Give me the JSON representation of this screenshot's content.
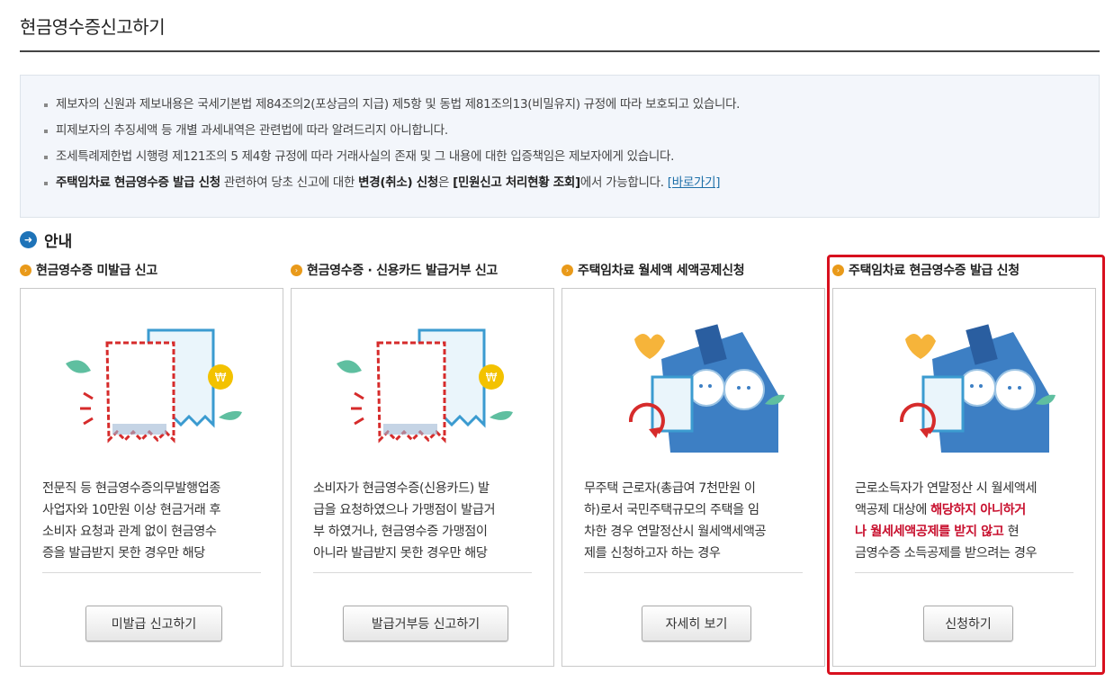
{
  "page": {
    "title": "현금영수증신고하기"
  },
  "notice": {
    "items": [
      {
        "text": "제보자의 신원과 제보내용은 국세기본법 제84조의2(포상금의 지급) 제5항 및 동법 제81조의13(비밀유지) 규정에 따라 보호되고 있습니다."
      },
      {
        "text": "피제보자의 추징세액 등 개별 과세내역은 관련법에 따라 알려드리지 아니합니다."
      },
      {
        "text": "조세특례제한법 시행령 제121조의 5 제4항 규정에 따라 거래사실의 존재 및 그 내용에 대한 입증책임은 제보자에게 있습니다."
      }
    ],
    "last": {
      "bold1": "주택임차료 현금영수증 발급 신청",
      "text1": " 관련하여 당초 신고에 대한 ",
      "bold2": "변경(취소) 신청",
      "text2": "은 ",
      "bold3": "[민원신고 처리현황 조회]",
      "text3": "에서 가능합니다. ",
      "link": "[바로가기]"
    }
  },
  "guide": {
    "title": "안내"
  },
  "cards": [
    {
      "title": "현금영수증 미발급 신고",
      "lines": [
        "전문직 등 현금영수증의무발행업종",
        "사업자와 10만원 이상 현금거래 후",
        "소비자 요청과 관계 없이 현금영수",
        "증을 발급받지 못한 경우만 해당"
      ],
      "button": "미발급 신고하기",
      "icon": "receipt-coin-icon"
    },
    {
      "title": "현금영수증 · 신용카드 발급거부 신고",
      "lines": [
        "소비자가 현금영수증(신용카드) 발",
        "급을 요청하였으나 가맹점이 발급거",
        "부 하였거나, 현금영수증 가맹점이",
        "아니라 발급받지 못한 경우만 해당"
      ],
      "button": "발급거부등 신고하기",
      "icon": "receipt-coin-icon"
    },
    {
      "title": "주택임차료 월세액 세액공제신청",
      "lines": [
        "무주택 근로자(총급여 7천만원 이",
        "하)로서 국민주택규모의 주택을 임",
        "차한 경우 연말정산시 월세액세액공",
        "제를 신청하고자 하는 경우"
      ],
      "button": "자세히 보기",
      "icon": "house-refund-icon"
    },
    {
      "title": "주택임차료 현금영수증 발급 신청",
      "line1": "근로소득자가 연말정산 시 월세액세",
      "line2": "액공제 대상에 ",
      "red1": "해당하지 아니하거",
      "red2": "나 월세세액공제를 받지 않고",
      "line3": " 현",
      "line4": "금영수증 소득공제를 받으려는 경우",
      "button": "신청하기",
      "icon": "house-refund-icon"
    }
  ],
  "colors": {
    "accent_red": "#d8101e",
    "link_blue": "#1d6fa8",
    "guide_blue": "#1e73b8",
    "bullet_orange": "#e99a1a"
  }
}
